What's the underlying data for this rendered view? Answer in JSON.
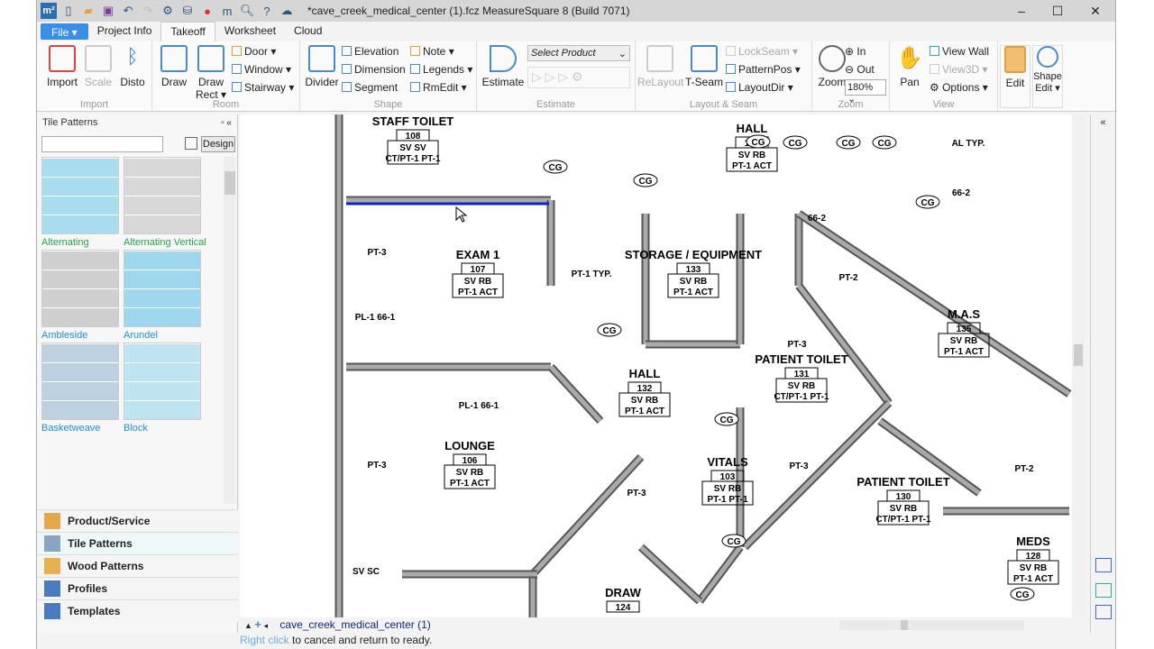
{
  "app": {
    "title": "*cave_creek_medical_center (1).fcz   MeasureSquare 8 (Build 7071)",
    "logo": "m²"
  },
  "tabs": [
    {
      "label": "File ▾"
    },
    {
      "label": "Project Info"
    },
    {
      "label": "Takeoff",
      "active": true
    },
    {
      "label": "Worksheet"
    },
    {
      "label": "Cloud"
    }
  ],
  "ribbon": {
    "import": {
      "label": "Import",
      "items": [
        "Import",
        "Scale",
        "Disto"
      ]
    },
    "room": {
      "label": "Room",
      "big": [
        "Draw",
        "Draw Rect ▾"
      ],
      "small": [
        "Door",
        "Window",
        "Stairway"
      ]
    },
    "shape": {
      "label": "Shape",
      "big": [
        "Divider"
      ],
      "small": [
        "Elevation",
        "Dimension",
        "Segment",
        "Note",
        "Legends",
        "RmEdit ▾"
      ]
    },
    "estimate": {
      "label": "Estimate",
      "big": "Estimate",
      "product_placeholder": "Select Product"
    },
    "layout": {
      "label": "Layout & Seam",
      "big": [
        "ReLayout",
        "T-Seam"
      ],
      "small": [
        "LockSeam",
        "PatternPos",
        "LayoutDir"
      ]
    },
    "zoom": {
      "label": "Zoom",
      "big": "Zoom",
      "small": [
        "In",
        "Out"
      ],
      "level": "180%"
    },
    "view": {
      "label": "View",
      "big": "Pan",
      "small": [
        "View Wall",
        "View3D",
        "Options ▾"
      ]
    },
    "edit": {
      "edit": "Edit",
      "shape_edit": "Shape Edit ▾"
    }
  },
  "left_panel": {
    "title": "Tile Patterns",
    "design": "Design",
    "patterns": [
      "Alternating",
      "Alternating Vertical",
      "Ambleside",
      "Arundel",
      "Basketweave",
      "Block"
    ],
    "accordion": [
      "Product/Service",
      "Tile Patterns",
      "Wood Patterns",
      "Profiles",
      "Templates"
    ]
  },
  "canvas": {
    "sheet_tab": "cave_creek_medical_center (1)",
    "rooms": [
      {
        "name": "STAFF TOILET",
        "num": "108",
        "f": "SV  SV",
        "m": "CT/PT-1 PT-1"
      },
      {
        "name": "HALL",
        "num": "134",
        "f": "SV  RB",
        "m": "PT-1 ACT"
      },
      {
        "name": "EXAM 1",
        "num": "107",
        "f": "SV  RB",
        "m": "PT-1 ACT"
      },
      {
        "name": "STORAGE / EQUIPMENT",
        "num": "133",
        "f": "SV  RB",
        "m": "PT-1 ACT"
      },
      {
        "name": "M.A.S",
        "num": "135",
        "f": "SV  RB",
        "m": "PT-1 ACT"
      },
      {
        "name": "PATIENT TOILET",
        "num": "131",
        "f": "SV  RB",
        "m": "CT/PT-1 PT-1"
      },
      {
        "name": "HALL",
        "num": "132",
        "f": "SV  RB",
        "m": "PT-1 ACT"
      },
      {
        "name": "LOUNGE",
        "num": "106",
        "f": "SV  RB",
        "m": "PT-1 ACT"
      },
      {
        "name": "VITALS",
        "num": "103",
        "f": "SV  RB",
        "m": "PT-1 PT-1"
      },
      {
        "name": "PATIENT TOILET",
        "num": "130",
        "f": "SV  RB",
        "m": "CT/PT-1 PT-1"
      },
      {
        "name": "MEDS",
        "num": "128",
        "f": "SV  RB",
        "m": "PT-1 ACT"
      },
      {
        "name": "DRAW",
        "num": "124",
        "f": "",
        "m": ""
      }
    ],
    "tags": [
      "CG",
      "PT-3",
      "PT-1 TYP.",
      "PL-1 66-1",
      "66-2",
      "PT-2",
      "AL TYP.",
      "SV SC"
    ]
  },
  "status": {
    "highlight": "Right click",
    "text": " to cancel and return to ready."
  }
}
